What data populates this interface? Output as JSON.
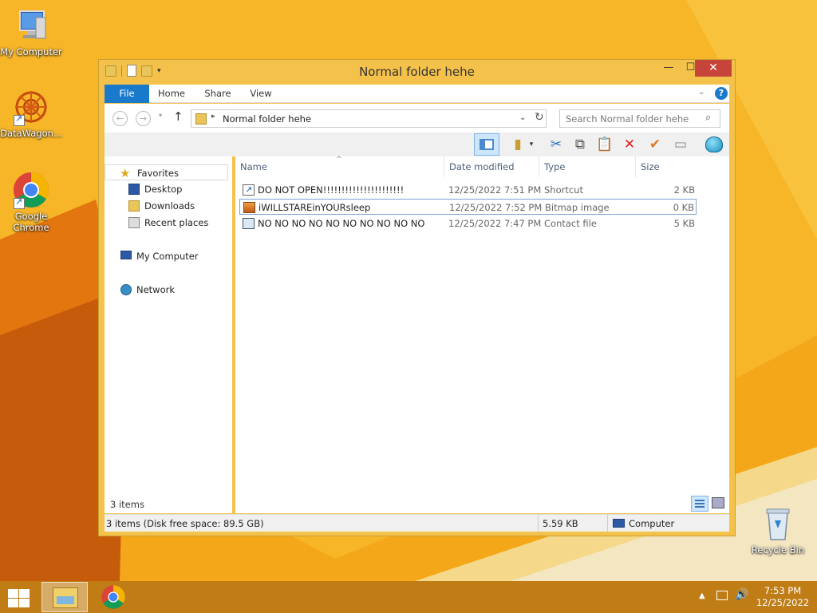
{
  "desktop": {
    "icons": [
      {
        "label": "My Computer"
      },
      {
        "label": "DataWagon..."
      },
      {
        "label": "Google Chrome"
      },
      {
        "label": "Recycle Bin"
      }
    ]
  },
  "window": {
    "title": "Normal folder  hehe",
    "buttons": {
      "minimize": "—",
      "maximize": "☐",
      "close": "✕"
    },
    "ribbon_tabs": [
      "File",
      "Home",
      "Share",
      "View"
    ],
    "ribbon_expand": "⌄",
    "help": "?",
    "address": {
      "path": "Normal folder  hehe",
      "chevron": "▸",
      "dropdown": "⌄",
      "refresh": "↻"
    },
    "search_placeholder": "Search Normal folder  hehe",
    "nav_buttons": {
      "back": "←",
      "forward": "→",
      "recent": "▾",
      "up": "↑"
    },
    "toolbar_glyphs": {
      "caret": "▾",
      "cut": "✂",
      "copy": "⧉",
      "paste": "📋",
      "delete": "✕",
      "rename": "✔",
      "box": "▭"
    }
  },
  "navpane": {
    "favorites": "Favorites",
    "items": [
      "Desktop",
      "Downloads",
      "Recent places"
    ],
    "my_computer": "My Computer",
    "network": "Network"
  },
  "filelist": {
    "columns": [
      "Name",
      "Date modified",
      "Type",
      "Size"
    ],
    "sort_caret": "^",
    "rows": [
      {
        "name": "DO NOT OPEN!!!!!!!!!!!!!!!!!!!!!!",
        "date": "12/25/2022 7:51 PM",
        "type": "Shortcut",
        "size": "2 KB",
        "icon": "shortcut-icon"
      },
      {
        "name": "iWILLSTAREinYOURsleep",
        "date": "12/25/2022 7:52 PM",
        "type": "Bitmap image",
        "size": "0 KB",
        "icon": "bitmap-icon"
      },
      {
        "name": "NO NO NO NO NO NO NO NO NO NO",
        "date": "12/25/2022 7:47 PM",
        "type": "Contact file",
        "size": "5 KB",
        "icon": "contact-icon"
      }
    ],
    "item_count": "3 items"
  },
  "statusbar": {
    "text": "3 items (Disk free space: 89.5 GB)",
    "size": "5.59 KB",
    "zone": "Computer"
  },
  "taskbar": {
    "tray_up": "▲",
    "volume": "🔊",
    "time": "7:53 PM",
    "date": "12/25/2022"
  },
  "colors": {
    "accent": "#1979ca",
    "close": "#c7443b",
    "window_frame": "#f4c24a",
    "desktop": "#f2a51a"
  }
}
